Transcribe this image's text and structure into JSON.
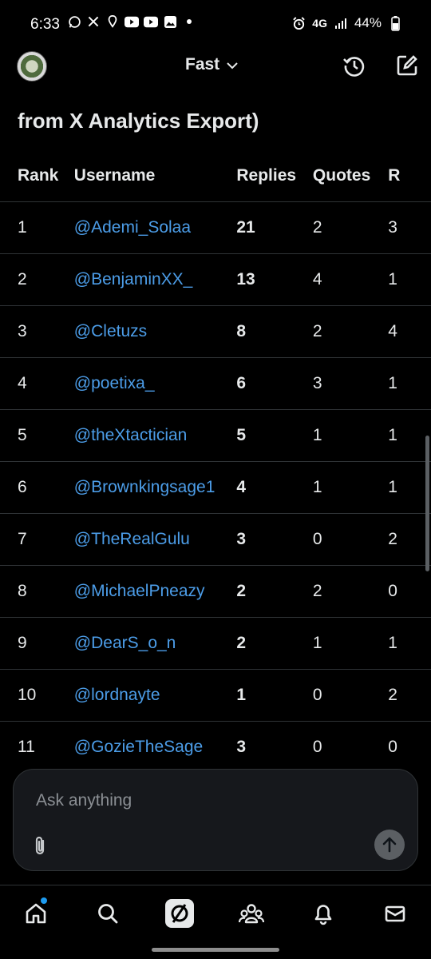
{
  "status_bar": {
    "time": "6:33",
    "network": "4G",
    "battery": "44%"
  },
  "header": {
    "model_label": "Fast"
  },
  "content": {
    "heading": "from X Analytics Export)"
  },
  "table": {
    "columns": [
      "Rank",
      "Username",
      "Replies",
      "Quotes",
      "R"
    ],
    "rows": [
      {
        "rank": "1",
        "user": "@Ademi_Solaa",
        "replies": "21",
        "quotes": "2",
        "r": "3"
      },
      {
        "rank": "2",
        "user": "@BenjaminXX_",
        "replies": "13",
        "quotes": "4",
        "r": "1"
      },
      {
        "rank": "3",
        "user": "@Cletuzs",
        "replies": "8",
        "quotes": "2",
        "r": "4"
      },
      {
        "rank": "4",
        "user": "@poetixa_",
        "replies": "6",
        "quotes": "3",
        "r": "1"
      },
      {
        "rank": "5",
        "user": "@theXtactician",
        "replies": "5",
        "quotes": "1",
        "r": "1"
      },
      {
        "rank": "6",
        "user": "@Brownkingsage1",
        "replies": "4",
        "quotes": "1",
        "r": "1"
      },
      {
        "rank": "7",
        "user": "@TheRealGulu",
        "replies": "3",
        "quotes": "0",
        "r": "2"
      },
      {
        "rank": "8",
        "user": "@MichaelPneazy",
        "replies": "2",
        "quotes": "2",
        "r": "0"
      },
      {
        "rank": "9",
        "user": "@DearS_o_n",
        "replies": "2",
        "quotes": "1",
        "r": "1"
      },
      {
        "rank": "10",
        "user": "@lordnayte",
        "replies": "1",
        "quotes": "0",
        "r": "2"
      },
      {
        "rank": "11",
        "user": "@GozieTheSage",
        "replies": "3",
        "quotes": "0",
        "r": "0"
      }
    ]
  },
  "composer": {
    "placeholder": "Ask anything"
  },
  "nav": {
    "items": [
      "home-icon",
      "search-icon",
      "grok-icon",
      "communities-icon",
      "notifications-icon",
      "messages-icon"
    ],
    "accent": "#1d9bf0"
  },
  "colors": {
    "background": "#000000",
    "link": "#4c9de8",
    "text": "#e7e9ea"
  }
}
